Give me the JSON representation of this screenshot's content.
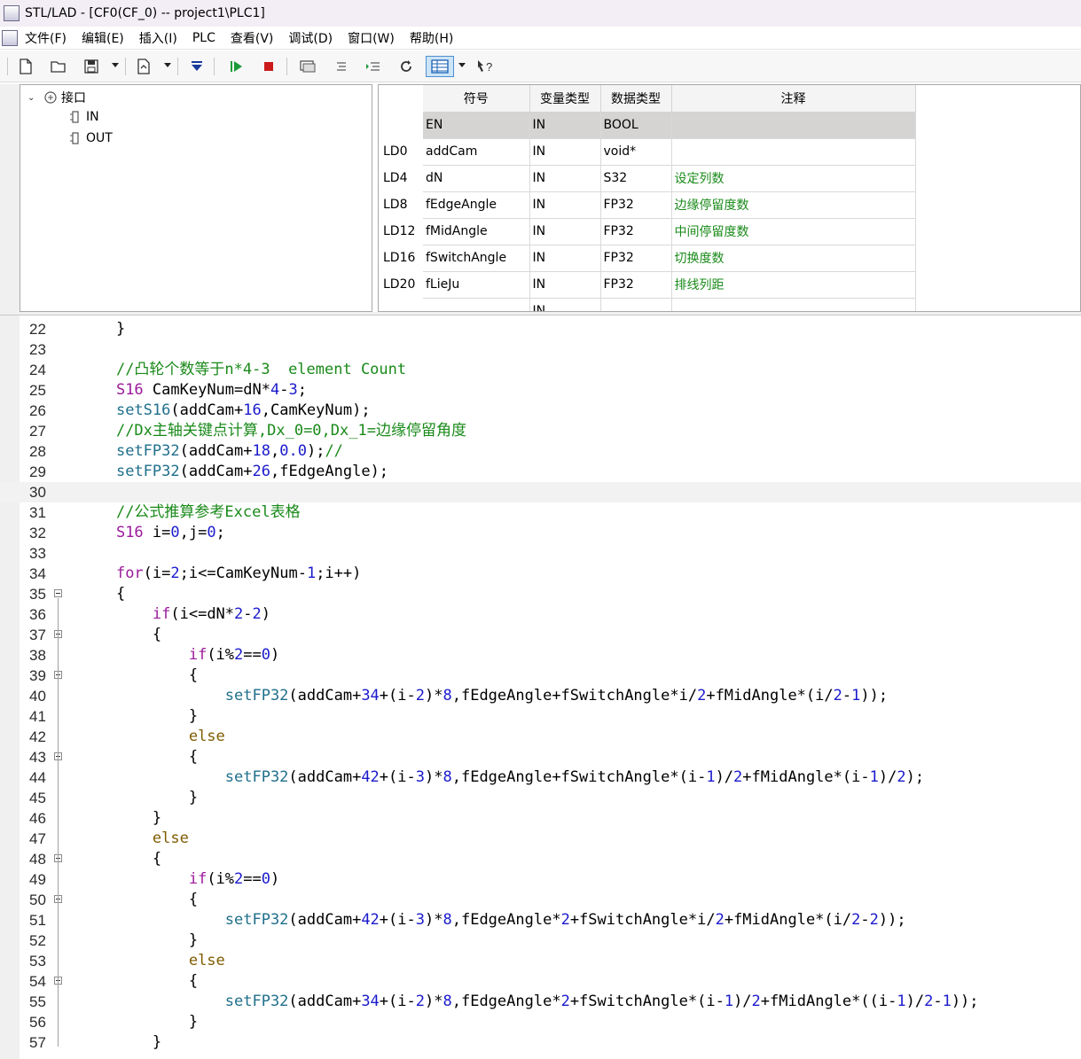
{
  "window": {
    "title": "STL/LAD - [CF0(CF_0) -- project1\\PLC1]"
  },
  "menu": [
    "文件(F)",
    "编辑(E)",
    "插入(I)",
    "PLC",
    "查看(V)",
    "调试(D)",
    "窗口(W)",
    "帮助(H)"
  ],
  "toolbar": {
    "icons": [
      "new-file-icon",
      "open-folder-icon",
      "save-icon",
      "export-icon",
      "download-icon",
      "run-icon",
      "stop-icon",
      "monitor-icon",
      "step-icon",
      "step-into-icon",
      "refresh-icon",
      "table-view-icon",
      "context-help-icon"
    ],
    "colors": {
      "run": "#1a9a3a",
      "stop": "#cc1a1a",
      "download": "#1a3a9a"
    }
  },
  "tree": {
    "root": "接口",
    "children": [
      "IN",
      "OUT"
    ]
  },
  "vars": {
    "headers": {
      "symbol": "符号",
      "var_type": "变量类型",
      "data_type": "数据类型",
      "comment": "注释"
    },
    "rows": [
      {
        "addr": "",
        "symbol": "EN",
        "var_type": "IN",
        "data_type": "BOOL",
        "comment": ""
      },
      {
        "addr": "LD0",
        "symbol": "addCam",
        "var_type": "IN",
        "data_type": "void*",
        "comment": ""
      },
      {
        "addr": "LD4",
        "symbol": "dN",
        "var_type": "IN",
        "data_type": "S32",
        "comment": "设定列数"
      },
      {
        "addr": "LD8",
        "symbol": "fEdgeAngle",
        "var_type": "IN",
        "data_type": "FP32",
        "comment": "边缘停留度数"
      },
      {
        "addr": "LD12",
        "symbol": "fMidAngle",
        "var_type": "IN",
        "data_type": "FP32",
        "comment": "中间停留度数"
      },
      {
        "addr": "LD16",
        "symbol": "fSwitchAngle",
        "var_type": "IN",
        "data_type": "FP32",
        "comment": "切换度数"
      },
      {
        "addr": "LD20",
        "symbol": "fLieJu",
        "var_type": "IN",
        "data_type": "FP32",
        "comment": "排线列距"
      },
      {
        "addr": "",
        "symbol": "",
        "var_type": "IN",
        "data_type": "",
        "comment": ""
      }
    ]
  },
  "editor": {
    "lines": [
      {
        "no": "22",
        "text": "    }"
      },
      {
        "no": "23",
        "text": ""
      },
      {
        "no": "24",
        "text": "    //凸轮个数等于n*4-3  element Count"
      },
      {
        "no": "25",
        "text": "    S16 CamKeyNum=dN*4-3;"
      },
      {
        "no": "26",
        "text": "    setS16(addCam+16,CamKeyNum);"
      },
      {
        "no": "27",
        "text": "    //Dx主轴关键点计算,Dx_0=0,Dx_1=边缘停留角度"
      },
      {
        "no": "28",
        "text": "    setFP32(addCam+18,0.0);//"
      },
      {
        "no": "29",
        "text": "    setFP32(addCam+26,fEdgeAngle);"
      },
      {
        "no": "30",
        "text": ""
      },
      {
        "no": "31",
        "text": "    //公式推算参考Excel表格"
      },
      {
        "no": "32",
        "text": "    S16 i=0,j=0;"
      },
      {
        "no": "33",
        "text": ""
      },
      {
        "no": "34",
        "text": "    for(i=2;i<=CamKeyNum-1;i++)"
      },
      {
        "no": "35",
        "text": "    {"
      },
      {
        "no": "36",
        "text": "        if(i<=dN*2-2)"
      },
      {
        "no": "37",
        "text": "        {"
      },
      {
        "no": "38",
        "text": "            if(i%2==0)"
      },
      {
        "no": "39",
        "text": "            {"
      },
      {
        "no": "40",
        "text": "                setFP32(addCam+34+(i-2)*8,fEdgeAngle+fSwitchAngle*i/2+fMidAngle*(i/2-1));"
      },
      {
        "no": "41",
        "text": "            }"
      },
      {
        "no": "42",
        "text": "            else"
      },
      {
        "no": "43",
        "text": "            {"
      },
      {
        "no": "44",
        "text": "                setFP32(addCam+42+(i-3)*8,fEdgeAngle+fSwitchAngle*(i-1)/2+fMidAngle*(i-1)/2);"
      },
      {
        "no": "45",
        "text": "            }"
      },
      {
        "no": "46",
        "text": "        }"
      },
      {
        "no": "47",
        "text": "        else"
      },
      {
        "no": "48",
        "text": "        {"
      },
      {
        "no": "49",
        "text": "            if(i%2==0)"
      },
      {
        "no": "50",
        "text": "            {"
      },
      {
        "no": "51",
        "text": "                setFP32(addCam+42+(i-3)*8,fEdgeAngle*2+fSwitchAngle*i/2+fMidAngle*(i/2-2));"
      },
      {
        "no": "52",
        "text": "            }"
      },
      {
        "no": "53",
        "text": "            else"
      },
      {
        "no": "54",
        "text": "            {"
      },
      {
        "no": "55",
        "text": "                setFP32(addCam+34+(i-2)*8,fEdgeAngle*2+fSwitchAngle*(i-1)/2+fMidAngle*((i-1)/2-1));"
      },
      {
        "no": "56",
        "text": "            }"
      },
      {
        "no": "57",
        "text": "        }"
      }
    ],
    "current_line": "30",
    "fold_lines": [
      "35",
      "37",
      "39",
      "43",
      "48",
      "50",
      "54"
    ]
  }
}
